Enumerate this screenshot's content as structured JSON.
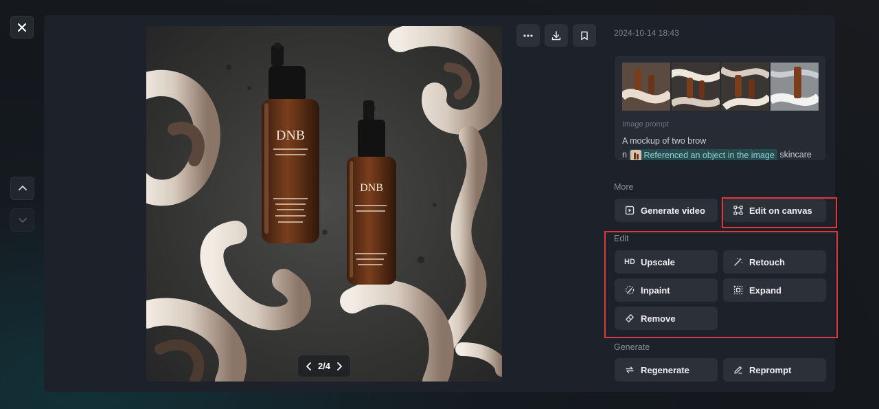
{
  "viewer": {
    "timestamp": "2024-10-14 18:43",
    "pager": {
      "current": 2,
      "total": 4,
      "text": "2/4"
    }
  },
  "icons": {
    "close": "close-icon",
    "up": "chevron-up-icon",
    "down": "chevron-down-icon",
    "more": "more-horizontal-icon",
    "download": "download-icon",
    "bookmark": "bookmark-icon"
  },
  "prompt": {
    "label": "Image prompt",
    "text_line1": "A mockup of two brow",
    "text_line2_prefix": "n",
    "reference_chip": "Referenced an object in the image",
    "text_line2_suffix": "skincare"
  },
  "more": {
    "label": "More",
    "buttons": {
      "generate_video": "Generate video",
      "edit_on_canvas": "Edit on canvas"
    }
  },
  "edit": {
    "label": "Edit",
    "buttons": {
      "upscale": "Upscale",
      "upscale_badge": "HD",
      "retouch": "Retouch",
      "inpaint": "Inpaint",
      "expand": "Expand",
      "remove": "Remove"
    }
  },
  "generate": {
    "label": "Generate",
    "buttons": {
      "regenerate": "Regenerate",
      "reprompt": "Reprompt"
    }
  },
  "image": {
    "bottle_label_large": "DNB",
    "bottle_label_small": "DNB"
  },
  "colors": {
    "highlight": "#e0373c",
    "chip_bg": "#274b4f",
    "chip_text": "#8fd3d3"
  }
}
